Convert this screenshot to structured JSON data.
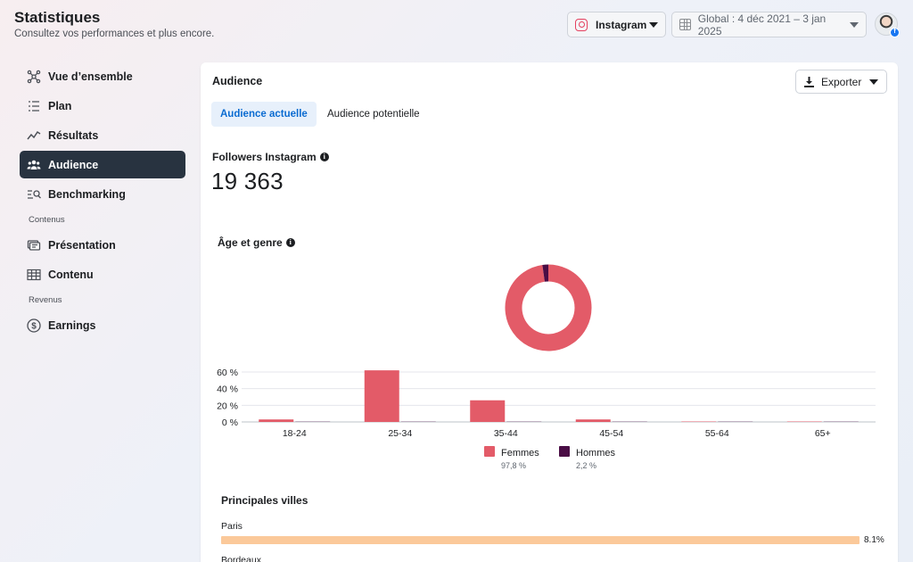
{
  "header": {
    "title": "Statistiques",
    "subtitle": "Consultez vos performances et plus encore.",
    "platform": "Instagram",
    "date_range": "Global : 4 déc 2021 – 3 jan 2025"
  },
  "sidebar": {
    "items": [
      {
        "label": "Vue d’ensemble",
        "icon": "network-icon"
      },
      {
        "label": "Plan",
        "icon": "list-icon"
      },
      {
        "label": "Résultats",
        "icon": "trend-icon"
      },
      {
        "label": "Audience",
        "icon": "people-icon",
        "active": true
      },
      {
        "label": "Benchmarking",
        "icon": "benchmark-search-icon"
      }
    ],
    "section_content": "Contenus",
    "content_items": [
      {
        "label": "Présentation",
        "icon": "presentation-icon"
      },
      {
        "label": "Contenu",
        "icon": "table-icon"
      }
    ],
    "section_revenue": "Revenus",
    "revenue_items": [
      {
        "label": "Earnings",
        "icon": "dollar-icon"
      }
    ]
  },
  "main": {
    "title": "Audience",
    "export_label": "Exporter",
    "tabs": [
      {
        "label": "Audience actuelle",
        "active": true
      },
      {
        "label": "Audience potentielle",
        "active": false
      }
    ],
    "followers_label": "Followers Instagram",
    "followers_value": "19 363",
    "age_gender_title": "Âge et genre",
    "cities_title": "Principales villes",
    "cities": [
      {
        "name": "Paris",
        "value": "8.1%",
        "fraction": 1.0
      },
      {
        "name": "Bordeaux",
        "value": "",
        "fraction": 0
      }
    ]
  },
  "colors": {
    "women": "#e35b68",
    "men": "#4a0d45",
    "city_bar": "#fbc99a",
    "active_nav": "#283340",
    "active_tab": "#0a6bd1"
  },
  "chart_data": {
    "type": "bar",
    "categories": [
      "18-24",
      "25-34",
      "35-44",
      "45-54",
      "55-64",
      "65+"
    ],
    "series": [
      {
        "name": "Femmes",
        "values": [
          3,
          62,
          26,
          3,
          0.5,
          0.5
        ],
        "total": "97,8 %"
      },
      {
        "name": "Hommes",
        "values": [
          0.5,
          0.5,
          0.5,
          0.5,
          0.5,
          0.5
        ],
        "total": "2,2 %"
      }
    ],
    "yticks": [
      "0 %",
      "20 %",
      "40 %",
      "60 %"
    ],
    "ylim": [
      0,
      60
    ],
    "grid": true,
    "legend": "bottom",
    "donut": {
      "type": "pie",
      "slices": [
        {
          "name": "Femmes",
          "value": 97.8
        },
        {
          "name": "Hommes",
          "value": 2.2
        }
      ]
    }
  }
}
